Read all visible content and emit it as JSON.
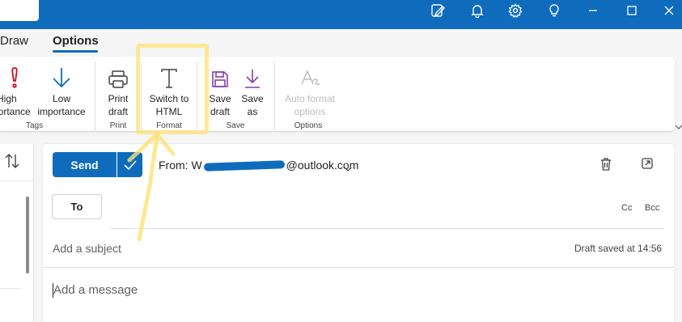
{
  "tabs": {
    "draw": "Draw",
    "options": "Options"
  },
  "ribbon": {
    "tags": {
      "high_line1": "High",
      "high_line2": "portance",
      "low_line1": "Low",
      "low_line2": "importance",
      "group": "Tags"
    },
    "print": {
      "line1": "Print",
      "line2": "draft",
      "group": "Print"
    },
    "format": {
      "line1": "Switch to",
      "line2": "HTML",
      "group": "Format"
    },
    "save": {
      "save_draft_line1": "Save",
      "save_draft_line2": "draft",
      "save_as_line1": "Save",
      "save_as_line2": "as",
      "group": "Save"
    },
    "options": {
      "line1": "Auto format",
      "line2": "options",
      "group": "Options"
    }
  },
  "compose": {
    "send_label": "Send",
    "from_prefix": "From: W",
    "from_suffix": "@outlook.com",
    "to_label": "To",
    "cc_label": "Cc",
    "bcc_label": "Bcc",
    "subject_placeholder": "Add a subject",
    "draft_status": "Draft saved at 14:56",
    "message_placeholder": "Add a message"
  },
  "colors": {
    "brand": "#0f6cbd",
    "high_importance": "#c50f1f",
    "low_importance": "#0f6cbd",
    "save_icons": "#8a3ea3",
    "highlight": "#fce278"
  }
}
